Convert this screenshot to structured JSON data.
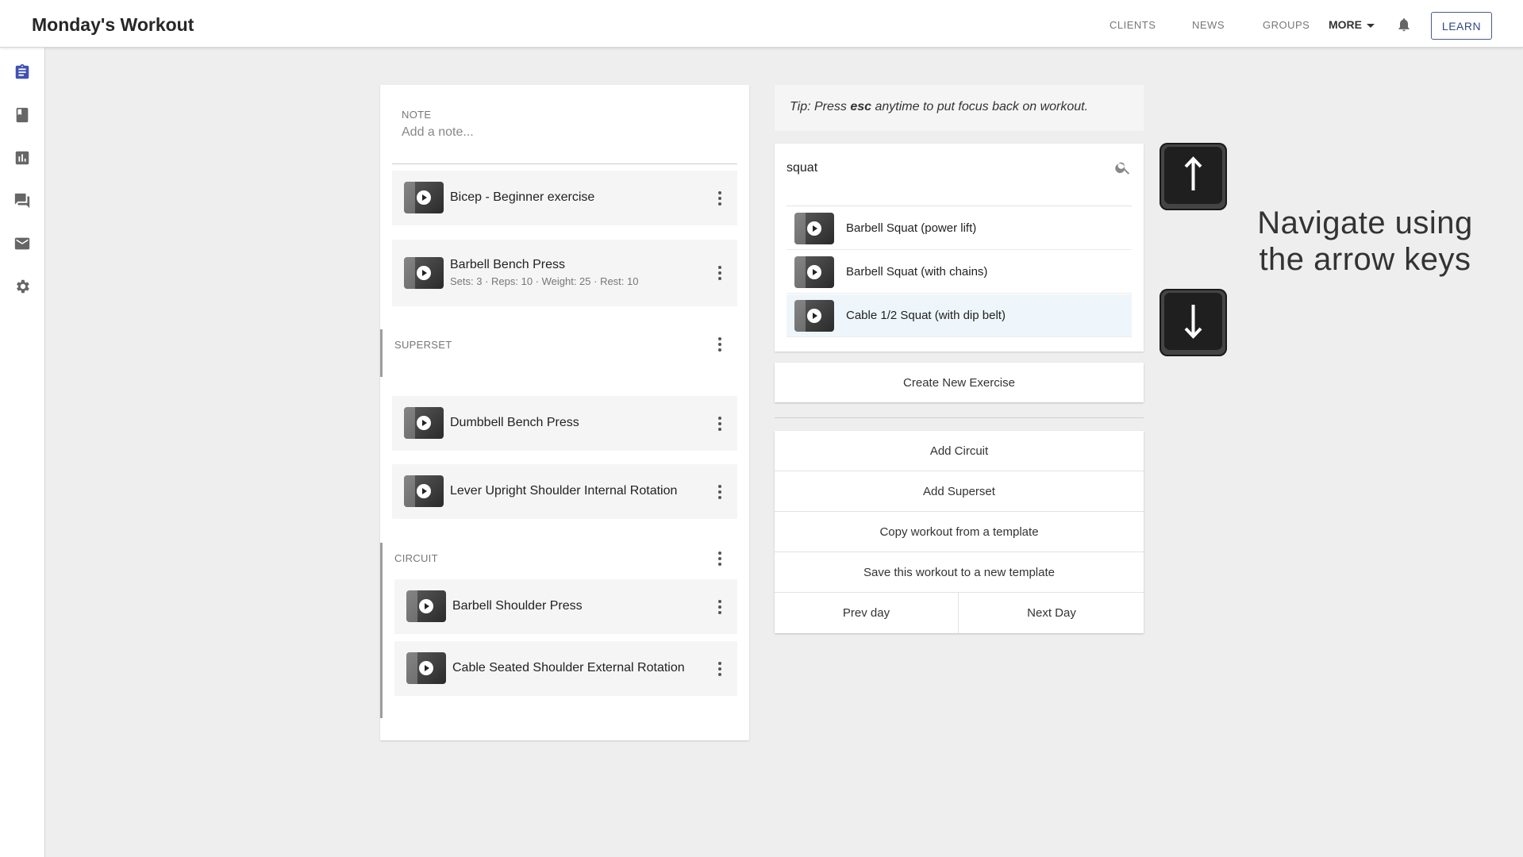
{
  "header": {
    "title": "Monday's Workout",
    "nav": [
      "CLIENTS",
      "NEWS",
      "GROUPS"
    ],
    "more_label": "MORE",
    "learn_label": "LEARN"
  },
  "sidebar": {
    "items": [
      "clipboard-icon",
      "book-icon",
      "bar-chart-icon",
      "chat-icon",
      "mail-icon",
      "gear-icon"
    ],
    "active_color": "#3f51b5"
  },
  "workout": {
    "note_label": "NOTE",
    "note_placeholder": "Add a note...",
    "exercises": [
      {
        "name": "Bicep - Beginner exercise"
      },
      {
        "name": "Barbell Bench Press",
        "meta": "Sets: 3 · Reps: 10 · Weight: 25 · Rest: 10"
      }
    ],
    "superset": {
      "label": "SUPERSET",
      "exercises": [
        "Dumbbell Bench Press",
        "Lever Upright Shoulder Internal Rotation"
      ]
    },
    "circuit": {
      "label": "CIRCUIT",
      "exercises": [
        "Barbell Shoulder Press",
        "Cable Seated Shoulder External Rotation"
      ]
    }
  },
  "search": {
    "tip_prefix": "Tip: Press ",
    "tip_key": "esc",
    "tip_suffix": " anytime to put focus back on workout.",
    "query": "squat",
    "results": [
      "Barbell Squat (power lift)",
      "Barbell Squat (with chains)",
      "Cable 1/2 Squat (with dip belt)"
    ],
    "highlighted_index": 2
  },
  "actions": {
    "create": "Create New Exercise",
    "add_circuit": "Add Circuit",
    "add_superset": "Add Superset",
    "copy_template": "Copy workout from a template",
    "save_template": "Save this workout to a new template",
    "prev_day": "Prev day",
    "next_day": "Next Day"
  },
  "overlay": {
    "hint_line1": "Navigate using",
    "hint_line2": "the arrow keys"
  }
}
